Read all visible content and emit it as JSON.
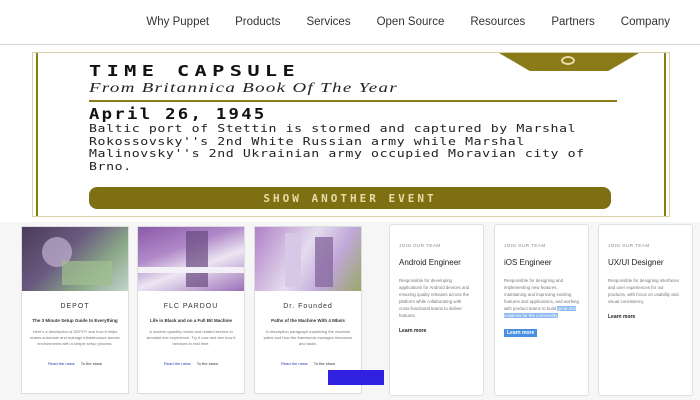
{
  "nav": {
    "items": [
      "Why Puppet",
      "Products",
      "Services",
      "Open Source",
      "Resources",
      "Partners",
      "Company"
    ]
  },
  "time_capsule": {
    "title": "TIME CAPSULE",
    "subtitle": "From Britannica Book Of The Year",
    "date": "April 26, 1945",
    "body": "Baltic port of Stettin is stormed and captured by Marshal Rokossovsky''s 2nd White Russian army while Marshal Malinovsky''s 2nd Ukrainian army occupied Moravian city of Brno.",
    "button": "SHOW ANOTHER EVENT",
    "accent": "#8a7a18"
  },
  "products": [
    {
      "name": "DEPOT",
      "tagline": "The 3 Minute Setup Guide to Everything",
      "desc": "Here's a description of DEPOT and how it helps teams automate and manage infrastructure across environments with a simple setup process.",
      "read": "Read the news",
      "details": "To the show",
      "image_palette": [
        "#5a4a6a",
        "#7fa070",
        "#c0d0c8"
      ]
    },
    {
      "name": "FLC PARDOU",
      "tagline": "Life in Black and on a Full Bit Machine",
      "desc": "A modern quantity model and related service to simulate live experience. Try it now and see how it behaves in real time.",
      "read": "Read the news",
      "details": "To the show",
      "image_palette": [
        "#9a6ab0",
        "#e8e0f0",
        "#a88ac8"
      ]
    },
    {
      "name": "Dr. Founded",
      "tagline": "Paths of the Machine With 4 Mbs/s",
      "desc": "A description paragraph explaining the machine paths and how the framework manages resources and tasks.",
      "read": "Read the news",
      "details": "To the show",
      "image_palette": [
        "#b080c8",
        "#dcd0e8",
        "#a0b070"
      ]
    }
  ],
  "jobs": [
    {
      "label": "JOIN OUR TEAM",
      "title": "Android Engineer",
      "desc": "Responsible for developing applications for Android devices and ensuring quality releases across the platform while collaborating with cross-functional teams to deliver features.",
      "highlight": "",
      "learn": "Learn more",
      "learn_selected": false
    },
    {
      "label": "JOIN OUR TEAM",
      "title": "iOS Engineer",
      "desc": "Responsible for designing and implementing new features, maintaining and improving existing features and applications, and working with product teams to build",
      "highlight": "great iOS solutions for the community.",
      "learn": "Learn more",
      "learn_selected": true
    },
    {
      "label": "JOIN OUR TEAM",
      "title": "UX/UI Designer",
      "desc": "Responsible for designing interfaces and user experiences for our products, with focus on usability and visual consistency.",
      "highlight": "",
      "learn": "Learn more",
      "learn_selected": false
    }
  ]
}
